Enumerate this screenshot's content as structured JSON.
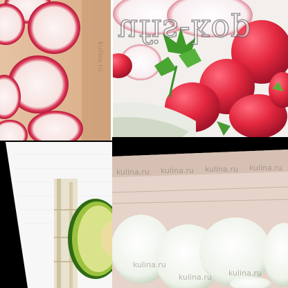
{
  "collage": {
    "watermark_main": "ufis-kop",
    "watermark_strip": "kulina.ru",
    "board_marks": [
      "kulina.ru",
      "kulina.ru",
      "kulina.ru",
      "kulina.ru"
    ],
    "bottom_marks": [
      "kulina.ru",
      "kulina.ru",
      "kulina.ru"
    ]
  }
}
